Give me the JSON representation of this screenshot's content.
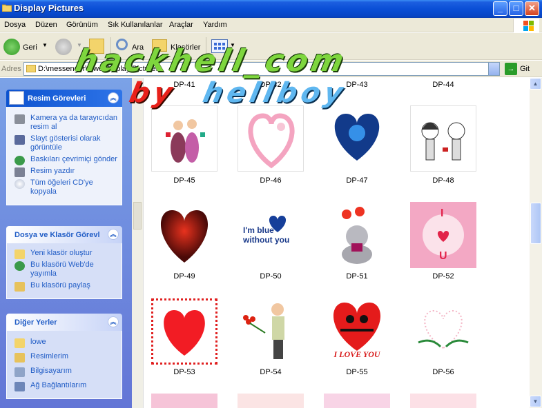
{
  "window": {
    "title": "Display Pictures"
  },
  "menu": [
    "Dosya",
    "Düzen",
    "Görünüm",
    "Sık Kullanılanlar",
    "Araçlar",
    "Yardım"
  ],
  "toolbar": {
    "back": "Geri",
    "search": "Ara",
    "folders": "Klasörler"
  },
  "address": {
    "label": "Adres",
    "path": "D:\\messenger\\lowe\\Display Pictures",
    "go": "Git"
  },
  "panels": {
    "picture_tasks": {
      "title": "Resim Görevleri",
      "items": [
        "Kamera ya da tarayıcıdan resim al",
        "Slayt gösterisi olarak görüntüle",
        "Baskıları çevrimiçi gönder",
        "Resim yazdır",
        "Tüm öğeleri CD'ye kopyala"
      ]
    },
    "file_tasks": {
      "title": "Dosya ve Klasör Görevl",
      "items": [
        "Yeni klasör oluştur",
        "Bu klasörü Web'de yayımla",
        "Bu klasörü paylaş"
      ]
    },
    "other_places": {
      "title": "Diğer Yerler",
      "items": [
        "lowe",
        "Resimlerim",
        "Bilgisayarım",
        "Ağ Bağlantılarım"
      ]
    }
  },
  "files": {
    "row0": [
      "DP-41",
      "DP-42",
      "DP-43",
      "DP-44"
    ],
    "row1": [
      "DP-45",
      "DP-46",
      "DP-47",
      "DP-48"
    ],
    "row2": [
      "DP-49",
      "DP-50",
      "DP-51",
      "DP-52"
    ],
    "row3": [
      "DP-53",
      "DP-54",
      "DP-55",
      "DP-56"
    ]
  },
  "thumbs": {
    "dp50_text": "I'm blue without you",
    "dp52_top": "I",
    "dp52_bottom": "U",
    "dp55_text": "I LOVE YOU"
  },
  "watermark": {
    "line1": "hackhell_com",
    "by": "by",
    "name": "hellboy"
  }
}
